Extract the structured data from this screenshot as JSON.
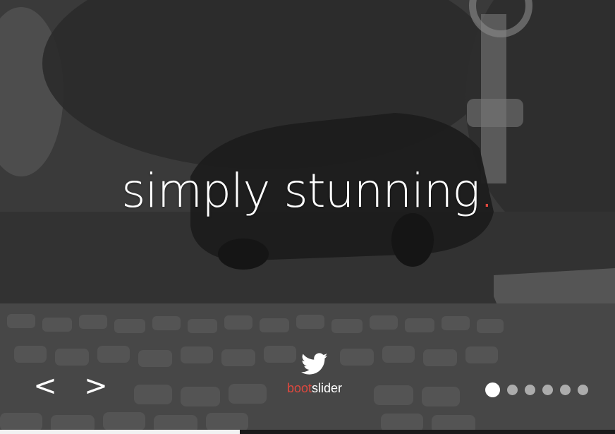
{
  "slider": {
    "headline": "simply stunning",
    "headline_punctuation": ".",
    "accent_color": "#e0483e",
    "prev_label": "<",
    "next_label": ">",
    "brand": {
      "icon": "twitter-bird-icon",
      "part1": "boot",
      "part2": "slider"
    },
    "slide_count": 6,
    "active_slide": 1,
    "progress": 0.39
  }
}
